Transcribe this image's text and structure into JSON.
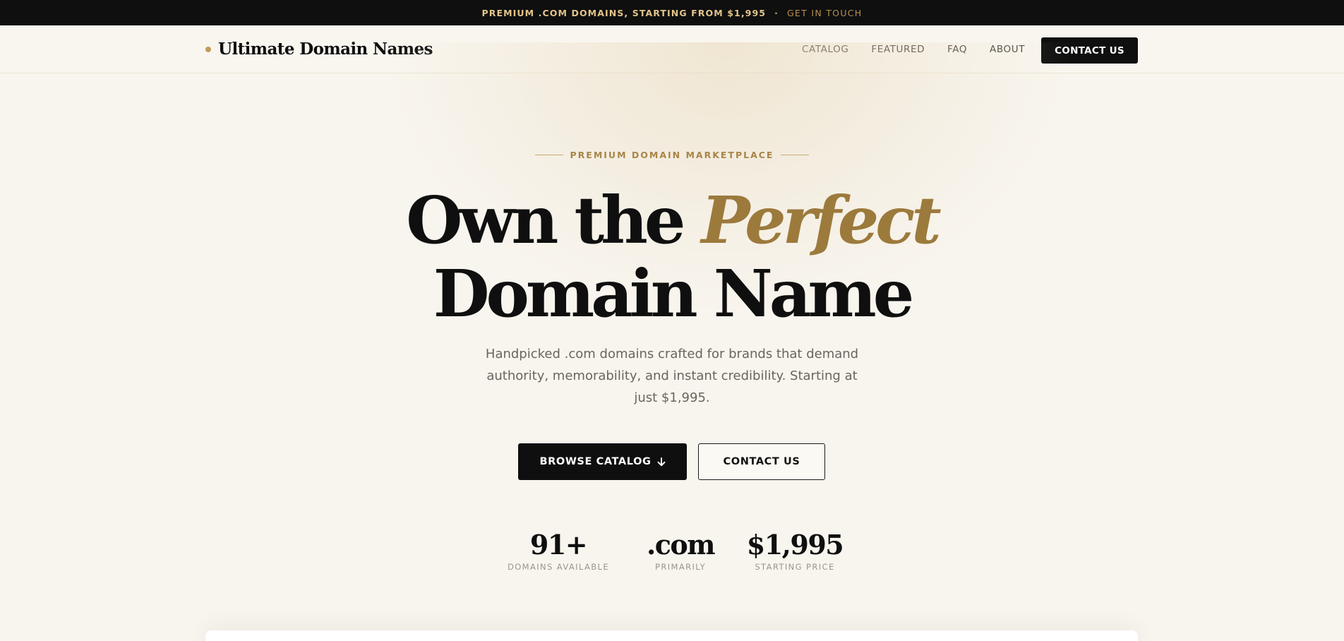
{
  "topbar": {
    "promo": "PREMIUM .COM DOMAINS, STARTING FROM $1,995",
    "separator": "·",
    "cta": "GET IN TOUCH"
  },
  "nav": {
    "brand": "Ultimate Domain Names",
    "links": [
      "CATALOG",
      "FEATURED",
      "FAQ",
      "ABOUT"
    ],
    "cta": "CONTACT US"
  },
  "hero": {
    "eyebrow": "PREMIUM DOMAIN MARKETPLACE",
    "headline_part1": "Own the ",
    "headline_accent": "Perfect",
    "headline_line2": "Domain Name",
    "lede": "Handpicked .com domains crafted for brands that demand authority, memorability, and instant credibility. Starting at just $1,995.",
    "primary_button": "BROWSE CATALOG",
    "primary_button_icon": "arrow-down-icon",
    "secondary_button": "CONTACT US"
  },
  "stats": [
    {
      "value": "91+",
      "label": "DOMAINS AVAILABLE"
    },
    {
      "value": ".com",
      "label": "PRIMARILY"
    },
    {
      "value": "$1,995",
      "label": "STARTING PRICE"
    }
  ],
  "colors": {
    "accent_gold": "#9c7a3c",
    "dark": "#0f0f0f",
    "background": "#f8f5ee"
  }
}
